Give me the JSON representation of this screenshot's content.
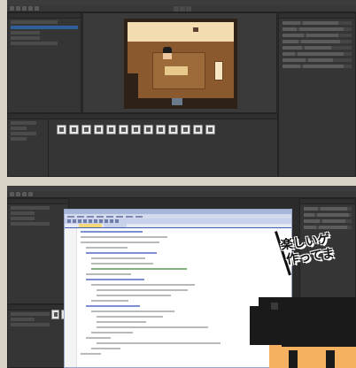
{
  "top_editor": {
    "asset_count": 13,
    "colors": {
      "wall": "#f2dcb0",
      "floor": "#8a5a2e",
      "editor_bg": "#2b2b2b",
      "selection": "#2d5f9a"
    }
  },
  "bottom_editor": {
    "visible_asset_count": 2,
    "code_window_colors": {
      "title": "#a9b6dc",
      "active_tab": "#f5d976",
      "tab_underline": "#3c5fb2"
    }
  },
  "caption": {
    "line1": "楽しいゲ",
    "line2": "作ってま"
  },
  "character": {
    "hair_color": "#1a1a1a",
    "skin_color": "#f5b060"
  }
}
